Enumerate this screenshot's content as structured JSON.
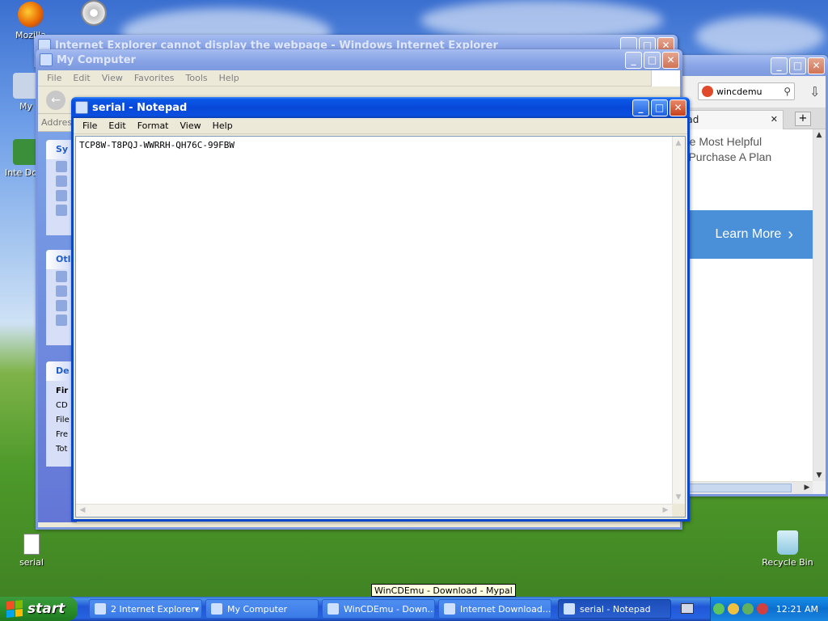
{
  "desktop": {
    "icons": [
      {
        "label": "Mozilla"
      },
      {
        "label": "My"
      },
      {
        "label": "Inte Dowi"
      },
      {
        "label": "serial"
      },
      {
        "label": "Recycle Bin"
      }
    ]
  },
  "ie_window": {
    "title": "Internet Explorer cannot display the webpage - Windows Internet Explorer"
  },
  "browser_window": {
    "search_value": "wincdemu",
    "tab_label": "oad",
    "promo_line1": "the Most Helpful",
    "promo_line2": "'. Purchase A Plan",
    "banner_label": "Learn More",
    "banner_arrow": "›",
    "close_tab": "✕",
    "new_tab": "+",
    "colors": {
      "banner": "#4a90d8"
    }
  },
  "mycomputer": {
    "title": "My Computer",
    "menu": [
      "File",
      "Edit",
      "View",
      "Favorites",
      "Tools",
      "Help"
    ],
    "address_label": "Addres",
    "sections": [
      "Sy",
      "Otl",
      "De"
    ],
    "details": [
      "Fir",
      "CD",
      "File",
      "Fre",
      "Tot"
    ]
  },
  "notepad": {
    "title": "serial - Notepad",
    "menu": [
      "File",
      "Edit",
      "Format",
      "View",
      "Help"
    ],
    "content": "TCP8W-T8PQJ-WWRRH-QH76C-99FBW"
  },
  "window_buttons": {
    "minimize": "_",
    "maximize": "□",
    "close": "✕"
  },
  "taskbar": {
    "start_label": "start",
    "buttons": [
      {
        "label": "2 Internet Explorer",
        "dropdown": "▾"
      },
      {
        "label": "My Computer"
      },
      {
        "label": "WinCDEmu - Down..."
      },
      {
        "label": "Internet Download..."
      },
      {
        "label": "serial - Notepad"
      }
    ],
    "clock": "12:21 AM"
  },
  "tooltip": "WinCDEmu - Download - Mypal"
}
